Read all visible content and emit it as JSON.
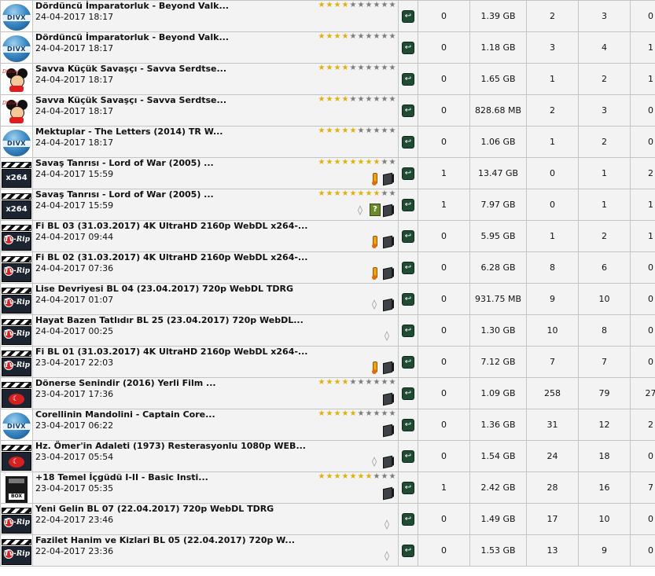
{
  "rows": [
    {
      "cat": "divx",
      "cat_text": "DIVX",
      "name": "Dördüncü İmparatorluk - Beyond Valk...",
      "date": "24-04-2017 18:17",
      "stars": 4,
      "icons": [],
      "comments": "0",
      "size": "1.39 GB",
      "files": "2",
      "seeders": "3",
      "leechers": "0"
    },
    {
      "cat": "divx",
      "cat_text": "DIVX",
      "name": "Dördüncü İmparatorluk - Beyond Valk...",
      "date": "24-04-2017 18:17",
      "stars": 4,
      "icons": [],
      "comments": "0",
      "size": "1.18 GB",
      "files": "3",
      "seeders": "4",
      "leechers": "1"
    },
    {
      "cat": "disney",
      "cat_text": "Disney",
      "name": "Savva Küçük Savaşçı - Savva Serdtse...",
      "date": "24-04-2017 18:17",
      "stars": 4,
      "icons": [],
      "comments": "0",
      "size": "1.65 GB",
      "files": "1",
      "seeders": "2",
      "leechers": "1"
    },
    {
      "cat": "disney",
      "cat_text": "Disney",
      "name": "Savva Küçük Savaşçı - Savva Serdtse...",
      "date": "24-04-2017 18:17",
      "stars": 4,
      "icons": [],
      "comments": "0",
      "size": "828.68 MB",
      "files": "2",
      "seeders": "3",
      "leechers": "0"
    },
    {
      "cat": "divx",
      "cat_text": "DIVX",
      "name": "Mektuplar - The Letters (2014) TR W...",
      "date": "24-04-2017 18:17",
      "stars": 5,
      "icons": [],
      "comments": "0",
      "size": "1.06 GB",
      "files": "1",
      "seeders": "2",
      "leechers": "0"
    },
    {
      "cat": "x264",
      "cat_text": "x264",
      "name": "Savaş Tanrısı - Lord of War (2005) ...",
      "date": "24-04-2017 15:59",
      "stars": 8,
      "icons": [
        "thermo",
        "cube"
      ],
      "comments": "1",
      "size": "13.47 GB",
      "files": "0",
      "seeders": "1",
      "leechers": "2"
    },
    {
      "cat": "x264",
      "cat_text": "x264",
      "name": "Savaş Tanrısı - Lord of War (2005) ...",
      "date": "24-04-2017 15:59",
      "stars": 8,
      "icons": [
        "audio",
        "q",
        "cube"
      ],
      "comments": "1",
      "size": "7.97 GB",
      "files": "0",
      "seeders": "1",
      "leechers": "1"
    },
    {
      "cat": "tvrip",
      "cat_text": "Tv-Rip",
      "name": "Fi BL 03 (31.03.2017) 4K UltraHD 2160p WebDL x264-...",
      "date": "24-04-2017 09:44",
      "stars": 0,
      "icons": [
        "thermo",
        "cube"
      ],
      "comments": "0",
      "size": "5.95 GB",
      "files": "1",
      "seeders": "2",
      "leechers": "1"
    },
    {
      "cat": "tvrip",
      "cat_text": "Tv-Rip",
      "name": "Fi BL 02 (31.03.2017) 4K UltraHD 2160p WebDL x264-...",
      "date": "24-04-2017 07:36",
      "stars": 0,
      "icons": [
        "thermo",
        "cube"
      ],
      "comments": "0",
      "size": "6.28 GB",
      "files": "8",
      "seeders": "6",
      "leechers": "0"
    },
    {
      "cat": "tvrip",
      "cat_text": "Tv-Rip",
      "name": "Lise Devriyesi BL 04 (23.04.2017) 720p WebDL TDRG",
      "date": "24-04-2017 01:07",
      "stars": 0,
      "icons": [
        "audio",
        "cube"
      ],
      "comments": "0",
      "size": "931.75 MB",
      "files": "9",
      "seeders": "10",
      "leechers": "0"
    },
    {
      "cat": "tvrip",
      "cat_text": "Tv-Rip",
      "name": "Hayat Bazen Tatlıdır BL 25 (23.04.2017) 720p WebDL...",
      "date": "24-04-2017 00:25",
      "stars": 0,
      "icons": [
        "audio"
      ],
      "comments": "0",
      "size": "1.30 GB",
      "files": "10",
      "seeders": "8",
      "leechers": "0"
    },
    {
      "cat": "tvrip",
      "cat_text": "Tv-Rip",
      "name": "Fi BL 01 (31.03.2017) 4K UltraHD 2160p WebDL x264-...",
      "date": "23-04-2017 22:03",
      "stars": 0,
      "icons": [
        "thermo",
        "cube"
      ],
      "comments": "0",
      "size": "7.12 GB",
      "files": "7",
      "seeders": "7",
      "leechers": "0"
    },
    {
      "cat": "tr",
      "cat_text": "",
      "name": "Dönerse Senindir (2016) Yerli Film ...",
      "date": "23-04-2017 17:36",
      "stars": 4,
      "icons": [
        "cube"
      ],
      "comments": "0",
      "size": "1.09 GB",
      "files": "258",
      "seeders": "79",
      "leechers": "27"
    },
    {
      "cat": "divx",
      "cat_text": "DIVX",
      "name": "Corellinin Mandolini - Captain Core...",
      "date": "23-04-2017 06:22",
      "stars": 5,
      "icons": [
        "cube"
      ],
      "comments": "0",
      "size": "1.36 GB",
      "files": "31",
      "seeders": "12",
      "leechers": "2"
    },
    {
      "cat": "tr",
      "cat_text": "",
      "name": "Hz. Ömer'in Adaleti (1973) Resterasyonlu 1080p WEB...",
      "date": "23-04-2017 05:54",
      "stars": 0,
      "icons": [
        "audio",
        "cube"
      ],
      "comments": "0",
      "size": "1.54 GB",
      "files": "24",
      "seeders": "18",
      "leechers": "0"
    },
    {
      "cat": "box",
      "cat_text": "BOX",
      "name": "+18 Temel İçgüdü I-II - Basic Insti...",
      "date": "23-04-2017 05:35",
      "stars": 7,
      "icons": [
        "cube"
      ],
      "comments": "1",
      "size": "2.42 GB",
      "files": "28",
      "seeders": "16",
      "leechers": "7"
    },
    {
      "cat": "tvrip",
      "cat_text": "Tv-Rip",
      "name": "Yeni Gelin BL 07 (22.04.2017) 720p WebDL TDRG",
      "date": "22-04-2017 23:46",
      "stars": 0,
      "icons": [
        "audio"
      ],
      "comments": "0",
      "size": "1.49 GB",
      "files": "17",
      "seeders": "10",
      "leechers": "0"
    },
    {
      "cat": "tvrip",
      "cat_text": "Tv-Rip",
      "name": "Fazilet Hanim ve Kizlari BL 05 (22.04.2017) 720p W...",
      "date": "22-04-2017 23:36",
      "stars": 0,
      "icons": [
        "audio"
      ],
      "comments": "0",
      "size": "1.53 GB",
      "files": "13",
      "seeders": "9",
      "leechers": "0"
    }
  ]
}
